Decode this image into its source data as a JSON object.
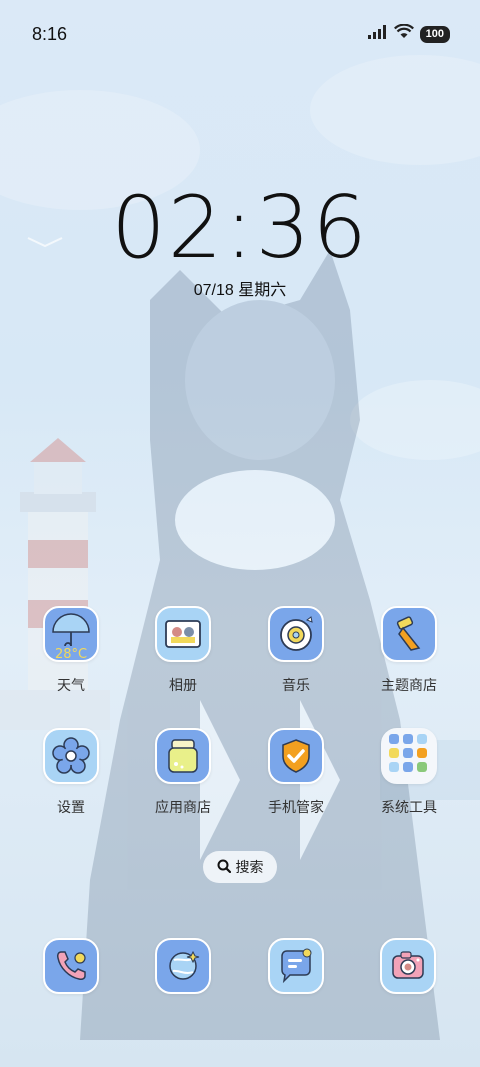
{
  "status_bar": {
    "time": "8:16",
    "battery": "100",
    "icons": [
      "signal-icon",
      "wifi-icon",
      "battery-icon"
    ]
  },
  "clock": {
    "time": "02:36",
    "date": "07/18 星期六"
  },
  "apps": [
    {
      "label": "天气",
      "icon": "weather-umbrella-icon",
      "icon_text": "28°C"
    },
    {
      "label": "相册",
      "icon": "gallery-icon"
    },
    {
      "label": "音乐",
      "icon": "music-disc-icon"
    },
    {
      "label": "主题商店",
      "icon": "theme-brush-icon"
    },
    {
      "label": "设置",
      "icon": "settings-flower-icon"
    },
    {
      "label": "应用商店",
      "icon": "app-store-bag-icon"
    },
    {
      "label": "手机管家",
      "icon": "phone-manager-shield-icon"
    },
    {
      "label": "系统工具",
      "icon": "system-tools-folder-icon"
    }
  ],
  "search": {
    "label": "搜索",
    "icon": "search-icon"
  },
  "dock": [
    {
      "icon": "phone-icon"
    },
    {
      "icon": "browser-icon"
    },
    {
      "icon": "messages-icon"
    },
    {
      "icon": "camera-icon"
    }
  ],
  "colors": {
    "icon_blue": "#7aa6ea",
    "icon_light_blue": "#a9d4f5",
    "accent_orange": "#f3a020",
    "accent_yellow": "#f2d95b",
    "wallpaper": "#d9e8f6"
  }
}
